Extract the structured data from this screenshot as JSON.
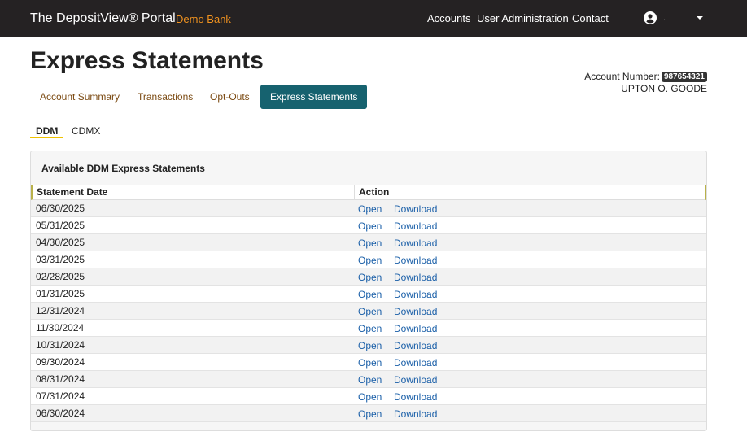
{
  "navbar": {
    "brand": "The DepositView® Portal",
    "bank_name": "Demo Bank",
    "links": [
      "Accounts",
      "User Administration",
      "Contact"
    ],
    "user_name": "."
  },
  "page": {
    "title": "Express Statements",
    "account_label": "Account Number:",
    "account_number": "987654321",
    "account_holder": "UPTON O. GOODE"
  },
  "tabs": [
    {
      "label": "Account Summary",
      "active": false
    },
    {
      "label": "Transactions",
      "active": false
    },
    {
      "label": "Opt-Outs",
      "active": false
    },
    {
      "label": "Express Statements",
      "active": true
    }
  ],
  "subtabs": [
    {
      "label": "DDM",
      "active": true
    },
    {
      "label": "CDMX",
      "active": false
    }
  ],
  "panel": {
    "title": "Available DDM Express Statements",
    "columns": [
      "Statement Date",
      "Action"
    ],
    "open_label": "Open",
    "download_label": "Download",
    "rows": [
      "06/30/2025",
      "05/31/2025",
      "04/30/2025",
      "03/31/2025",
      "02/28/2025",
      "01/31/2025",
      "12/31/2024",
      "11/30/2024",
      "10/31/2024",
      "09/30/2024",
      "08/31/2024",
      "07/31/2024",
      "06/30/2024"
    ]
  },
  "colors": {
    "navbar_bg": "#252223",
    "bank_accent": "#f0921f",
    "active_tab": "#16626f",
    "tab_text": "#7b4a12",
    "link": "#1a5fa8"
  }
}
